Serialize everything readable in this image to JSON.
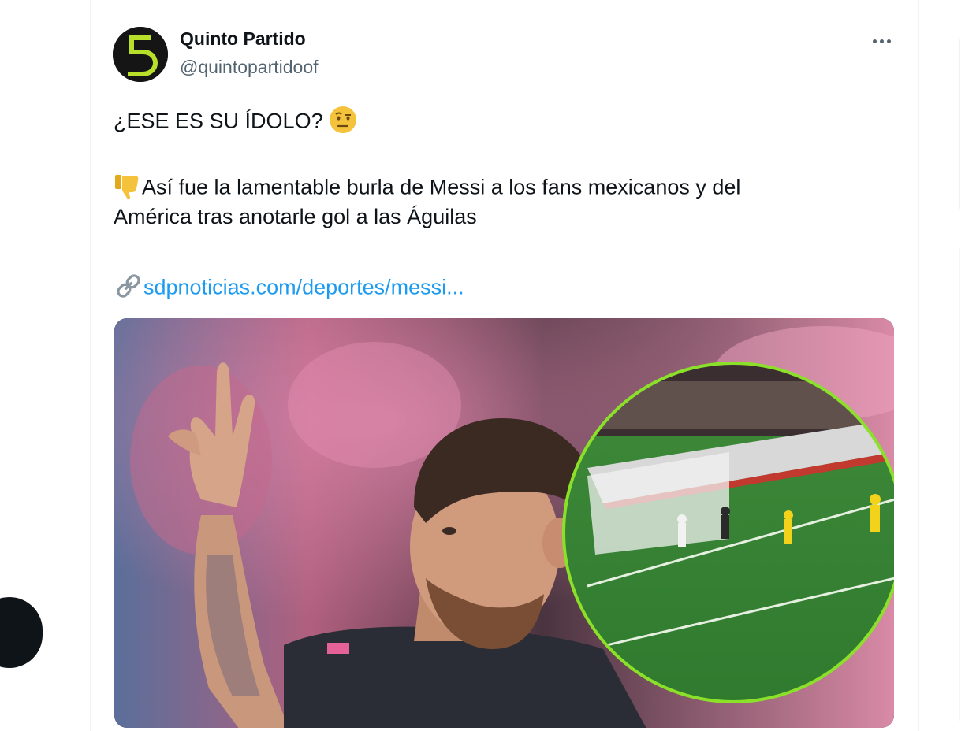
{
  "tweet": {
    "author": {
      "name": "Quinto Partido",
      "handle": "@quintopartidoof",
      "avatar_icon": "quinto-partido-logo-icon",
      "avatar_colors": {
        "background": "#151515",
        "accent": "#b8e02a"
      }
    },
    "more_icon": "more-options-icon",
    "text": {
      "line1": "¿ESE ES SU ÍDOLO? ",
      "line1_emoji": "face-with-raised-eyebrow-icon",
      "line2_emoji": "thumbs-down-icon",
      "line2": "Así fue la lamentable burla de Messi a los fans mexicanos y del",
      "line3": "América tras anotarle gol a las Águilas",
      "link_icon": "link-icon",
      "link": "sdpnoticias.com/deportes/messi..."
    },
    "media": {
      "kind": "photo",
      "description_icon": "player-celebration-photo-with-inset-goal-replay"
    }
  },
  "colors": {
    "text": "#0f1419",
    "secondary": "#536471",
    "link": "#1d9bf0",
    "border": "#eff3f4"
  }
}
